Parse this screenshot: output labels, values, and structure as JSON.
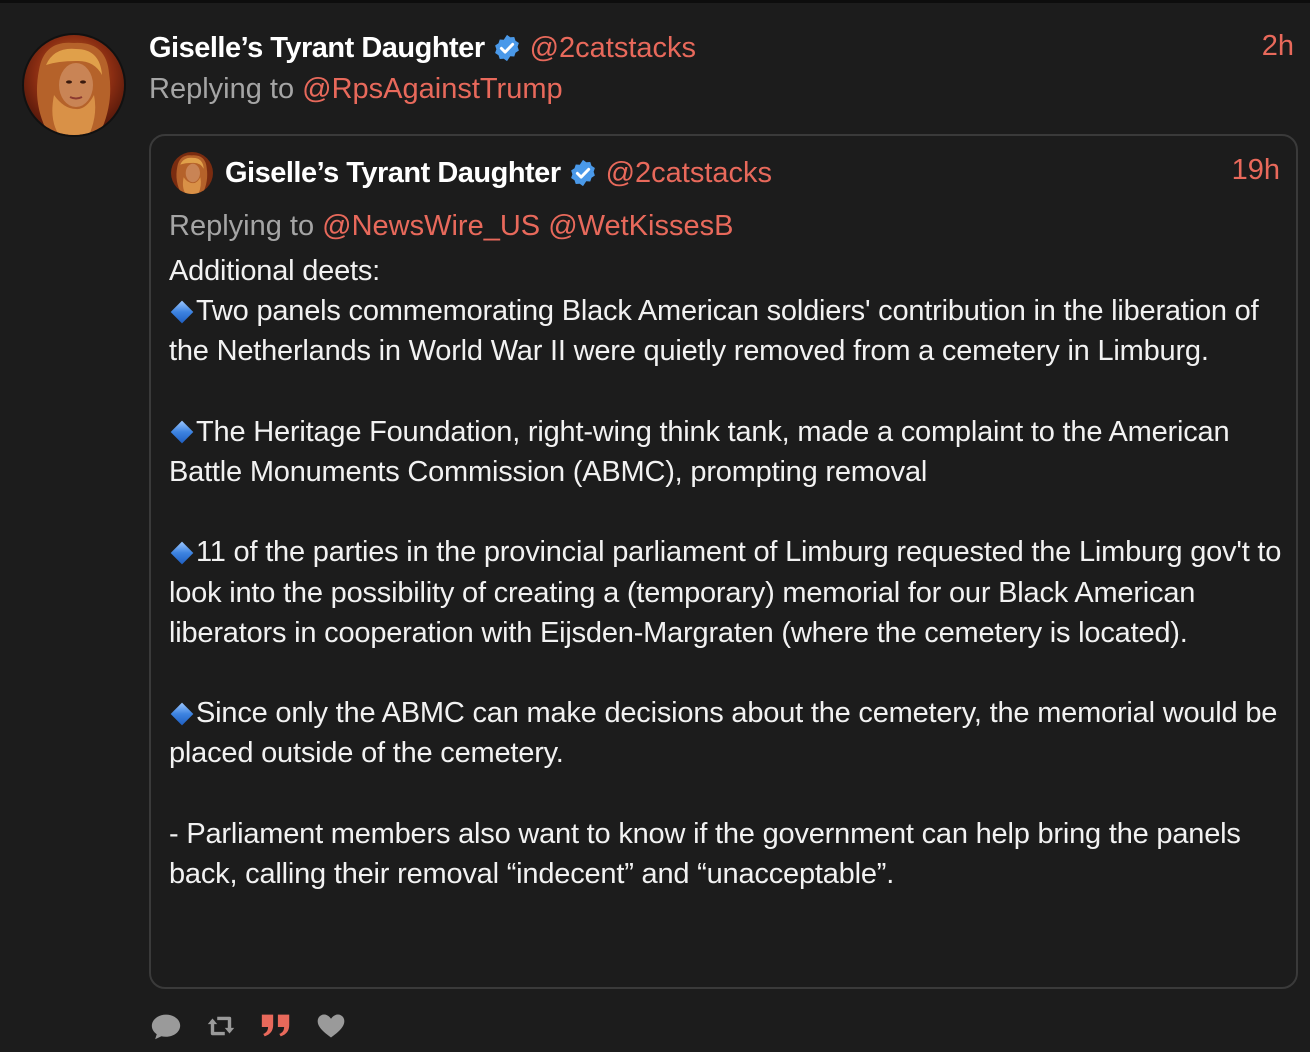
{
  "tweet": {
    "display_name": "Giselle’s Tyrant Daughter",
    "handle": "@2catstacks",
    "time": "2h",
    "reply_prefix": "Replying to ",
    "reply_to": "@RpsAgainstTrump"
  },
  "quote": {
    "display_name": "Giselle’s Tyrant Daughter",
    "handle": "@2catstacks",
    "time": "19h",
    "reply_prefix": "Replying to ",
    "reply_to_1": "@NewsWire_US",
    "reply_to_2": "@WetKissesB",
    "intro": "Additional deets:",
    "bullet_1": "Two panels commemorating Black American soldiers' contribution in the liberation of the Netherlands in World War II were quietly removed from a cemetery in Limburg.",
    "bullet_2": "The Heritage Foundation, right-wing think tank, made a complaint to the American Battle Monuments Commission (ABMC), prompting removal",
    "bullet_3": "11 of the parties in the provincial parliament of Limburg requested the Limburg gov't to look into the possibility of creating a (temporary) memorial for our Black American liberators in cooperation with Eijsden-Margraten (where the cemetery is located).",
    "bullet_4": "Since only the ABMC can make decisions about the cemetery, the memorial would be placed outside of the cemetery.",
    "closing": "- Parliament members also want to know if the government can help bring the panels back, calling their removal “indecent” and “unacceptable”."
  },
  "icons": {
    "verified": "verified-badge-icon",
    "bullet": "blue-diamond-icon",
    "reply": "comment-bubble-icon",
    "retweet": "retweet-icon",
    "quote": "quote-icon",
    "like": "heart-icon"
  },
  "colors": {
    "background": "#1c1c1c",
    "accent": "#e8695b",
    "muted_text": "#a5a5a5",
    "verified": "#4a99e9",
    "quote_border": "#3a3a3a"
  }
}
